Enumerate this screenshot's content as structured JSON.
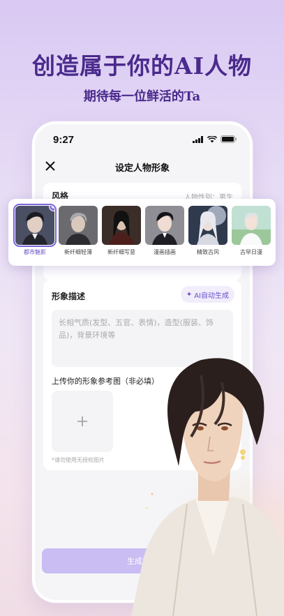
{
  "headline": "创造属于你的AI人物",
  "subline": "期待每一位鲜活的Ta",
  "status": {
    "time": "9:27"
  },
  "nav": {
    "title": "设定人物形象",
    "close_icon": "close-icon"
  },
  "style_section": {
    "label": "风格",
    "gender": "人物性别：男生",
    "items": [
      {
        "name": "都市魅影",
        "selected": true
      },
      {
        "name": "新纤细轻薄",
        "selected": false
      },
      {
        "name": "新纤细写意",
        "selected": false
      },
      {
        "name": "漫画插画",
        "selected": false
      },
      {
        "name": "精致古风",
        "selected": false
      },
      {
        "name": "古早日漫",
        "selected": false
      }
    ]
  },
  "description": {
    "title": "形象描述",
    "ai_button": "AI自动生成",
    "placeholder": "长相气质(发型、五官、表情)，造型(服装、饰品)，背景环境等"
  },
  "upload": {
    "title": "上传你的形象参考图（非必填）",
    "note": "*请勿使用无授权图片"
  },
  "generate_button": "生成高清",
  "colors": {
    "accent": "#6a4fc7",
    "headline": "#4a2a8c",
    "button": "#c9bdf3"
  }
}
